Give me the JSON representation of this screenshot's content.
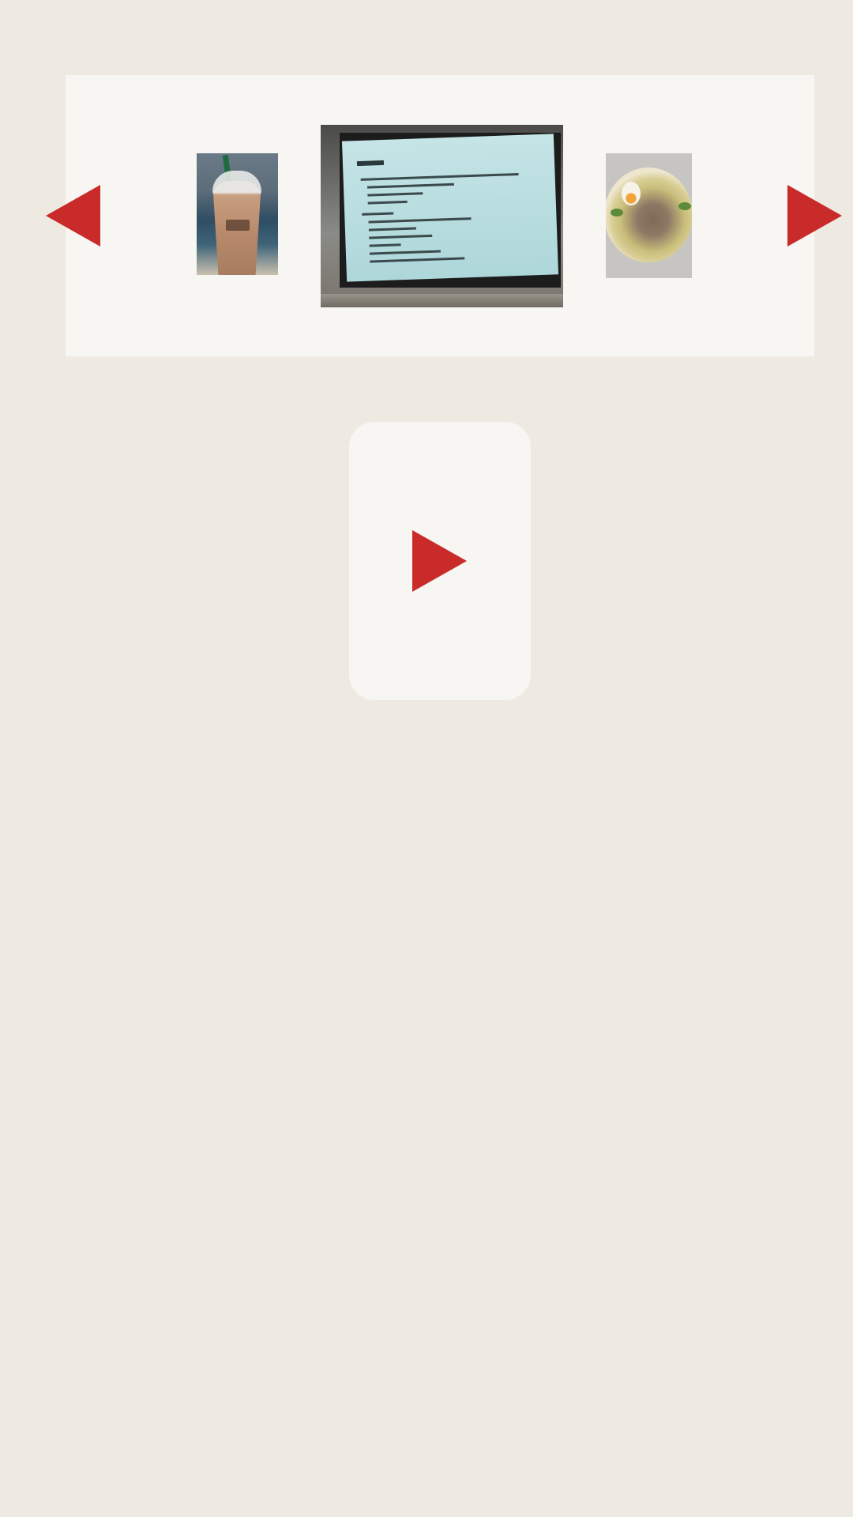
{
  "colors": {
    "background": "#efeae1",
    "panel": "#f7f6f2",
    "accent": "#c92a2a"
  },
  "gallery": {
    "thumbnails": [
      {
        "name": "iced-coffee-photo"
      },
      {
        "name": "projector-slide-photo"
      },
      {
        "name": "noodle-bowl-photo"
      }
    ],
    "prev_icon": "triangle-left",
    "next_icon": "triangle-right"
  },
  "video": {
    "play_icon": "triangle-right"
  }
}
